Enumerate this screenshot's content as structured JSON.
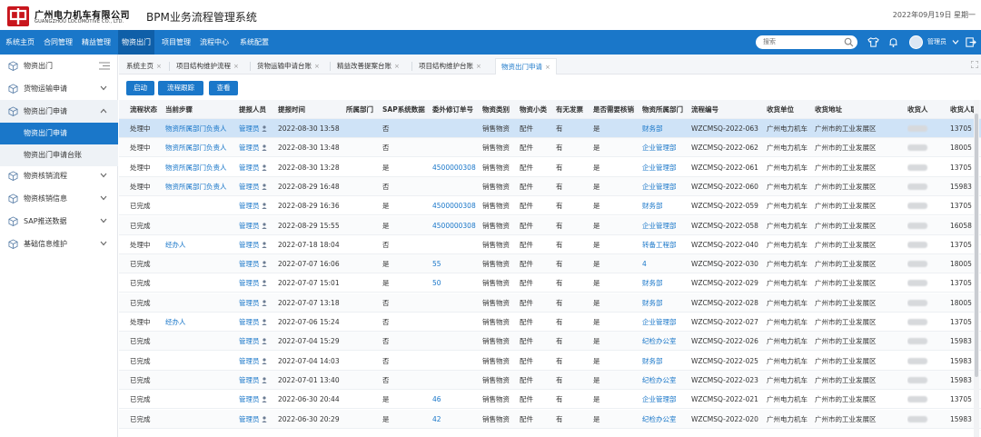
{
  "header": {
    "company_cn": "广州电力机车有限公司",
    "company_en": "GUANGZHOU LOCOMOTIVE CO., LTD.",
    "system_title": "BPM业务流程管理系统",
    "date": "2022年09月19日 星期一"
  },
  "nav": {
    "items": [
      "系统主页",
      "合同管理",
      "精益管理",
      "物资出门",
      "项目管理",
      "流程中心",
      "系统配置"
    ],
    "active": "物资出门",
    "search_placeholder": "搜索",
    "user": "管理员"
  },
  "sidebar": {
    "top": "物资出门",
    "groups": [
      {
        "label": "货物运输申请"
      },
      {
        "label": "物资出门申请",
        "open": true,
        "children": [
          {
            "label": "物资出门申请",
            "active": true
          },
          {
            "label": "物资出门申请台账"
          }
        ]
      },
      {
        "label": "物资核销流程"
      },
      {
        "label": "物资核销信息"
      },
      {
        "label": "SAP推送数据"
      },
      {
        "label": "基础信息维护"
      }
    ]
  },
  "tabs": [
    {
      "label": "系统主页"
    },
    {
      "label": "项目结构维护流程"
    },
    {
      "label": "货物运输申请台账"
    },
    {
      "label": "精益改善提案台账"
    },
    {
      "label": "项目结构维护台账"
    },
    {
      "label": "物资出门申请",
      "active": true
    }
  ],
  "toolbar": {
    "start": "启动",
    "track": "流程跟踪",
    "view": "查看"
  },
  "table": {
    "headers": [
      "流程状态",
      "当前步骤",
      "提报人员",
      "提报时间",
      "所属部门",
      "SAP系统数据",
      "委外修订单号",
      "物资类别",
      "物资小类",
      "有无发票",
      "是否需要核销",
      "物资所属部门",
      "流程编号",
      "收货单位",
      "收货地址",
      "收货人",
      "收货人联"
    ],
    "rows": [
      [
        "处理中",
        "物资所属部门负责人",
        "管理员",
        "2022-08-30 13:58",
        "",
        "否",
        "",
        "销售物资",
        "配件",
        "有",
        "是",
        "财务部",
        "WZCMSQ-2022-063",
        "广州电力机车",
        "广州市的工业发展区",
        "",
        "13705"
      ],
      [
        "处理中",
        "物资所属部门负责人",
        "管理员",
        "2022-08-30 13:48",
        "",
        "否",
        "",
        "销售物资",
        "配件",
        "有",
        "是",
        "企业管理部",
        "WZCMSQ-2022-062",
        "广州电力机车",
        "广州市的工业发展区",
        "",
        "18005"
      ],
      [
        "处理中",
        "物资所属部门负责人",
        "管理员",
        "2022-08-30 13:28",
        "",
        "是",
        "4500000308",
        "销售物资",
        "配件",
        "有",
        "是",
        "企业管理部",
        "WZCMSQ-2022-061",
        "广州电力机车",
        "广州市的工业发展区",
        "",
        "13705"
      ],
      [
        "处理中",
        "物资所属部门负责人",
        "管理员",
        "2022-08-29 16:48",
        "",
        "否",
        "",
        "销售物资",
        "配件",
        "有",
        "是",
        "企业管理部",
        "WZCMSQ-2022-060",
        "广州电力机车",
        "广州市的工业发展区",
        "",
        "15983"
      ],
      [
        "已完成",
        "",
        "管理员",
        "2022-08-29 16:36",
        "",
        "是",
        "4500000308",
        "销售物资",
        "配件",
        "有",
        "是",
        "财务部",
        "WZCMSQ-2022-059",
        "广州电力机车",
        "广州市的工业发展区",
        "",
        "13705"
      ],
      [
        "已完成",
        "",
        "管理员",
        "2022-08-29 15:55",
        "",
        "是",
        "4500000308",
        "销售物资",
        "配件",
        "有",
        "是",
        "企业管理部",
        "WZCMSQ-2022-058",
        "广州电力机车",
        "广州市的工业发展区",
        "",
        "16058"
      ],
      [
        "处理中",
        "经办人",
        "管理员",
        "2022-07-18 18:04",
        "",
        "否",
        "",
        "销售物资",
        "配件",
        "有",
        "是",
        "转备工程部",
        "WZCMSQ-2022-040",
        "广州电力机车",
        "广州市的工业发展区",
        "",
        "13705"
      ],
      [
        "已完成",
        "",
        "管理员",
        "2022-07-07 16:06",
        "",
        "是",
        "55",
        "销售物资",
        "配件",
        "有",
        "是",
        "4",
        "WZCMSQ-2022-030",
        "广州电力机车",
        "广州市的工业发展区",
        "",
        "18005"
      ],
      [
        "已完成",
        "",
        "管理员",
        "2022-07-07 15:01",
        "",
        "是",
        "50",
        "销售物资",
        "配件",
        "有",
        "是",
        "财务部",
        "WZCMSQ-2022-029",
        "广州电力机车",
        "广州市的工业发展区",
        "",
        "13705"
      ],
      [
        "已完成",
        "",
        "管理员",
        "2022-07-07 13:18",
        "",
        "否",
        "",
        "销售物资",
        "配件",
        "有",
        "是",
        "财务部",
        "WZCMSQ-2022-028",
        "广州电力机车",
        "广州市的工业发展区",
        "",
        "18005"
      ],
      [
        "处理中",
        "经办人",
        "管理员",
        "2022-07-06 15:24",
        "",
        "否",
        "",
        "销售物资",
        "配件",
        "有",
        "是",
        "企业管理部",
        "WZCMSQ-2022-027",
        "广州电力机车",
        "广州市的工业发展区",
        "",
        "13705"
      ],
      [
        "已完成",
        "",
        "管理员",
        "2022-07-04 15:29",
        "",
        "否",
        "",
        "销售物资",
        "配件",
        "有",
        "是",
        "纪检办公室",
        "WZCMSQ-2022-026",
        "广州电力机车",
        "广州市的工业发展区",
        "",
        "15983"
      ],
      [
        "已完成",
        "",
        "管理员",
        "2022-07-04 14:03",
        "",
        "否",
        "",
        "销售物资",
        "配件",
        "有",
        "是",
        "财务部",
        "WZCMSQ-2022-025",
        "广州电力机车",
        "广州市的工业发展区",
        "",
        "15983"
      ],
      [
        "已完成",
        "",
        "管理员",
        "2022-07-01 13:40",
        "",
        "否",
        "",
        "销售物资",
        "配件",
        "有",
        "是",
        "纪检办公室",
        "WZCMSQ-2022-023",
        "广州电力机车",
        "广州市的工业发展区",
        "",
        "15983"
      ],
      [
        "已完成",
        "",
        "管理员",
        "2022-06-30 20:44",
        "",
        "是",
        "46",
        "销售物资",
        "配件",
        "有",
        "是",
        "企业管理部",
        "WZCMSQ-2022-021",
        "广州电力机车",
        "广州市的工业发展区",
        "",
        "13705"
      ],
      [
        "已完成",
        "",
        "管理员",
        "2022-06-30 20:29",
        "",
        "是",
        "42",
        "销售物资",
        "配件",
        "有",
        "是",
        "纪检办公室",
        "WZCMSQ-2022-020",
        "广州电力机车",
        "广州市的工业发展区",
        "",
        "15983"
      ]
    ]
  },
  "colors": {
    "primary": "#1a77c9",
    "selected_row": "#cfe3f7",
    "brand_red": "#c8161d"
  }
}
